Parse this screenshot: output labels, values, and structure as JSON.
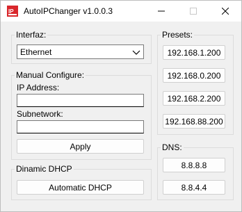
{
  "window": {
    "title": "AutoIPChanger v1.0.0.3",
    "icon": "ip-app-icon",
    "icon_text": "IP"
  },
  "interface": {
    "group_label": "Interfaz:",
    "selected": "Ethernet"
  },
  "manual": {
    "group_label": "Manual Configure:",
    "ip_label": "IP Address:",
    "ip_value": "",
    "subnet_label": "Subnetwork:",
    "subnet_value": "",
    "apply_label": "Apply"
  },
  "dhcp": {
    "group_label": "Dinamic DHCP",
    "button_label": "Automatic DHCP"
  },
  "presets": {
    "group_label": "Presets:",
    "items": [
      "192.168.1.200",
      "192.168.0.200",
      "192.168.2.200",
      "192.168.88.200"
    ]
  },
  "dns": {
    "group_label": "DNS:",
    "items": [
      "8.8.8.8",
      "8.8.4.4"
    ]
  },
  "colors": {
    "icon_red": "#d9262b",
    "border": "#dcdcdc",
    "background": "#f0f0f0"
  }
}
